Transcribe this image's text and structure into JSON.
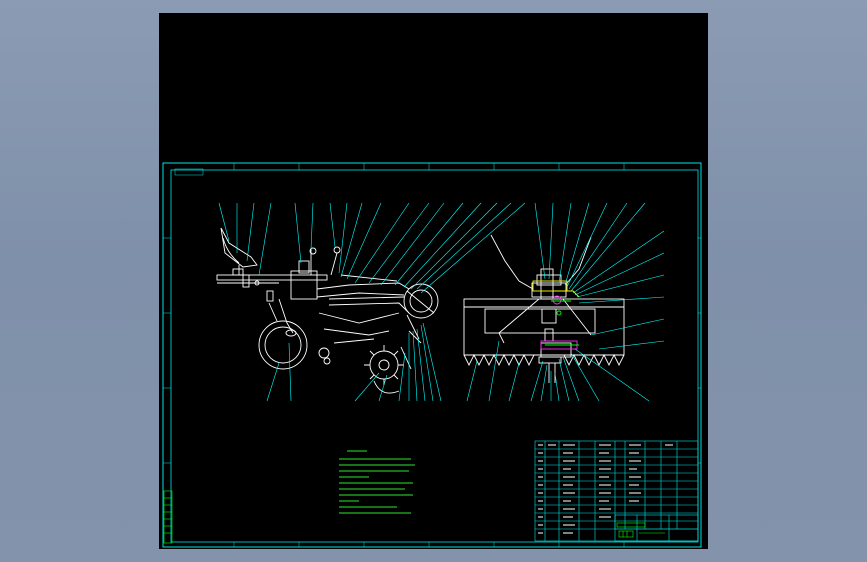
{
  "drawing": {
    "background": "#000000",
    "line_color": "#00ffff",
    "leader_color": "#00ffff",
    "part_color": "#ffffff",
    "text_color": "#00ff00",
    "title_text_color": "#ffff66"
  },
  "sheet": {
    "corner_tag": "",
    "title_block_name": "",
    "title_block_code": ""
  },
  "technical_requirements": {
    "heading": "",
    "lines": []
  },
  "icons": [
    "zoom-viewport-icon"
  ]
}
